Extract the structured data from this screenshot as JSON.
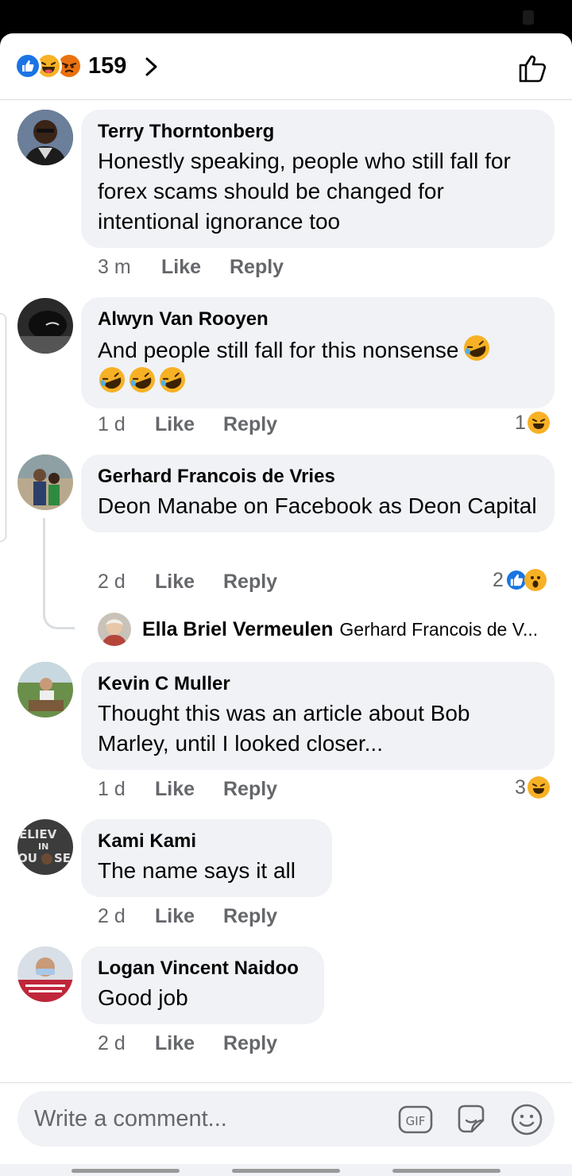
{
  "header": {
    "reaction_count": "159",
    "reactions": [
      "like-icon",
      "haha-icon",
      "angry-icon"
    ]
  },
  "comments": [
    {
      "author": "Terry Thorntonberg",
      "text": "Honestly speaking, people who still fall for forex scams should be changed for intentional ignorance too",
      "time": "3 m",
      "like": "Like",
      "reply": "Reply"
    },
    {
      "author": "Alwyn Van Rooyen",
      "text": "And people still fall for this nonsense",
      "emoji_after_text": [
        "rofl-icon",
        "rofl-icon",
        "rofl-icon",
        "rofl-icon"
      ],
      "time": "1 d",
      "like": "Like",
      "reply": "Reply",
      "reaction_count": "1",
      "reaction_icons": [
        "haha-icon"
      ]
    },
    {
      "author": "Gerhard Francois de Vries",
      "text": "Deon Manabe on Facebook as Deon Capital",
      "time": "2 d",
      "like": "Like",
      "reply": "Reply",
      "reaction_count": "2",
      "reaction_icons": [
        "like-icon",
        "wow-icon"
      ],
      "reply_preview": {
        "author": "Ella Briel Vermeulen",
        "snippet": "Gerhard Francois de V..."
      }
    },
    {
      "author": "Kevin C Muller",
      "text": "Thought this was an article about Bob Marley, until I looked closer...",
      "time": "1 d",
      "like": "Like",
      "reply": "Reply",
      "reaction_count": "3",
      "reaction_icons": [
        "haha-icon"
      ]
    },
    {
      "author": "Kami Kami",
      "text": "The name says it all",
      "time": "2 d",
      "like": "Like",
      "reply": "Reply"
    },
    {
      "author": "Logan Vincent Naidoo",
      "text": "Good job",
      "time": "2 d",
      "like": "Like",
      "reply": "Reply"
    }
  ],
  "composer": {
    "placeholder": "Write a comment...",
    "gif_label": "GIF"
  },
  "colors": {
    "accent": "#1b74e4",
    "bubble": "#f0f2f5",
    "meta_text": "#65676b",
    "haha": "#f7b125",
    "angry": "#e9710f"
  }
}
